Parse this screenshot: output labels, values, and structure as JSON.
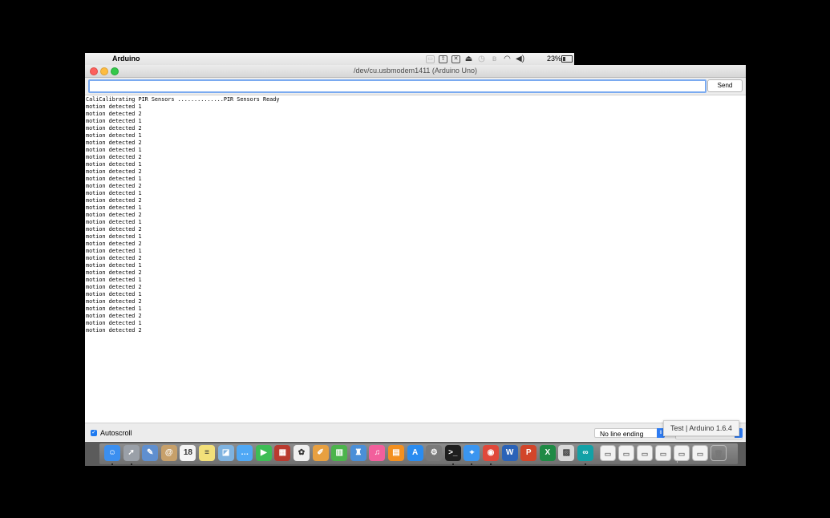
{
  "menubar": {
    "app_name": "Arduino",
    "battery_pct": "23%",
    "status_icons": [
      "display-icon",
      "upload-icon",
      "close-box-icon",
      "airplay-icon",
      "time-machine-icon",
      "bluetooth-icon",
      "wifi-icon",
      "volume-icon"
    ]
  },
  "window": {
    "title": "/dev/cu.usbmodem1411 (Arduino Uno)"
  },
  "toolbar": {
    "input_value": "",
    "send_label": "Send"
  },
  "output": {
    "lines": [
      "CaliCalibrating PIR Sensors ..............PIR Sensors Ready",
      "motion detected 1",
      "motion detected 2",
      "motion detected 1",
      "motion detected 2",
      "motion detected 1",
      "motion detected 2",
      "motion detected 1",
      "motion detected 2",
      "motion detected 1",
      "motion detected 2",
      "motion detected 1",
      "motion detected 2",
      "motion detected 1",
      "motion detected 2",
      "motion detected 1",
      "motion detected 2",
      "motion detected 1",
      "motion detected 2",
      "motion detected 1",
      "motion detected 2",
      "motion detected 1",
      "motion detected 2",
      "motion detected 1",
      "motion detected 2",
      "motion detected 1",
      "motion detected 2",
      "motion detected 1",
      "motion detected 2",
      "motion detected 1",
      "motion detected 2",
      "motion detected 1",
      "motion detected 2"
    ]
  },
  "statusbar": {
    "autoscroll_label": "Autoscroll",
    "autoscroll_checked": true,
    "line_ending": "No line ending"
  },
  "tooltip": {
    "text": "Test | Arduino 1.6.4"
  },
  "dock": {
    "icons": [
      {
        "name": "finder-icon",
        "color": "#3b8ff0",
        "glyph": "☺"
      },
      {
        "name": "launchpad-icon",
        "color": "#9aa0a8",
        "glyph": "➚"
      },
      {
        "name": "photo-app-icon",
        "color": "#5f8fcf",
        "glyph": "✎"
      },
      {
        "name": "contacts-icon",
        "color": "#c7a06a",
        "glyph": "@"
      },
      {
        "name": "calendar-icon",
        "color": "#f4f4f4",
        "glyph": "18"
      },
      {
        "name": "notes-icon",
        "color": "#f3e07a",
        "glyph": "≡"
      },
      {
        "name": "preview-icon",
        "color": "#7fb3e0",
        "glyph": "◪"
      },
      {
        "name": "messages-icon",
        "color": "#4fa8f5",
        "glyph": "…"
      },
      {
        "name": "facetime-icon",
        "color": "#3dbd55",
        "glyph": "▶"
      },
      {
        "name": "photo-booth-icon",
        "color": "#b93a2f",
        "glyph": "▦"
      },
      {
        "name": "photos-icon",
        "color": "#f0f0f0",
        "glyph": "✿"
      },
      {
        "name": "pages-icon",
        "color": "#e8a040",
        "glyph": "✐"
      },
      {
        "name": "numbers-icon",
        "color": "#4cb44c",
        "glyph": "▥"
      },
      {
        "name": "keynote-icon",
        "color": "#4a8fd8",
        "glyph": "♜"
      },
      {
        "name": "itunes-icon",
        "color": "#f25f9c",
        "glyph": "♫"
      },
      {
        "name": "ibooks-icon",
        "color": "#f39020",
        "glyph": "▤"
      },
      {
        "name": "app-store-icon",
        "color": "#2a8cf0",
        "glyph": "A"
      },
      {
        "name": "system-preferences-icon",
        "color": "#7a7a7a",
        "glyph": "⚙"
      },
      {
        "name": "terminal-icon",
        "color": "#1e1e1e",
        "glyph": ">_"
      },
      {
        "name": "safari-icon",
        "color": "#3a95f0",
        "glyph": "⌖"
      },
      {
        "name": "chrome-icon",
        "color": "#e0483a",
        "glyph": "◉"
      },
      {
        "name": "word-icon",
        "color": "#2b63b8",
        "glyph": "W"
      },
      {
        "name": "powerpoint-icon",
        "color": "#d2452a",
        "glyph": "P"
      },
      {
        "name": "excel-icon",
        "color": "#1f8a45",
        "glyph": "X"
      },
      {
        "name": "preview-document-icon",
        "color": "#d9d9d9",
        "glyph": "▨"
      },
      {
        "name": "arduino-icon",
        "color": "#13a1a6",
        "glyph": "∞"
      }
    ],
    "stack_icons": [
      {
        "name": "downloads-stack-icon"
      },
      {
        "name": "document-stack-icon-1"
      },
      {
        "name": "document-stack-icon-2"
      },
      {
        "name": "document-stack-icon-3"
      },
      {
        "name": "document-stack-icon-4"
      },
      {
        "name": "document-stack-icon-5"
      },
      {
        "name": "trash-icon"
      }
    ]
  }
}
